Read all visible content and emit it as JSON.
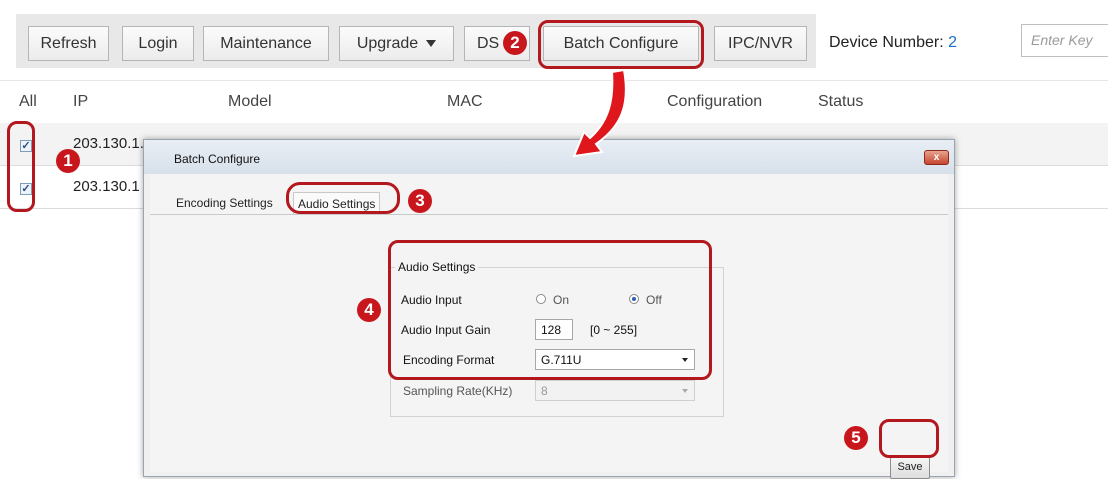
{
  "toolbar": {
    "buttons": [
      {
        "label": "Refresh"
      },
      {
        "label": "Login"
      },
      {
        "label": "Maintenance"
      },
      {
        "label": "Upgrade"
      },
      {
        "label": "DS"
      },
      {
        "label": "Batch Configure"
      },
      {
        "label": "IPC/NVR"
      }
    ],
    "device_number_label": "Device Number:",
    "device_number_value": "2",
    "search_placeholder": "Enter Key"
  },
  "table": {
    "headers": [
      "All",
      "IP",
      "Model",
      "MAC",
      "Configuration",
      "Status"
    ],
    "rows": [
      {
        "ip": "203.130.1.",
        "checked": true
      },
      {
        "ip": "203.130.1",
        "checked": true
      }
    ]
  },
  "dialog": {
    "title": "Batch Configure",
    "tabs": [
      "Encoding Settings",
      "Audio Settings"
    ],
    "active_tab": "Audio Settings",
    "group_title": "Audio Settings",
    "audio_input": {
      "label": "Audio Input",
      "on_label": "On",
      "off_label": "Off",
      "selected": "Off"
    },
    "audio_input_gain": {
      "label": "Audio Input Gain",
      "value": "128",
      "range": "[0 ~ 255]"
    },
    "encoding_format": {
      "label": "Encoding Format",
      "value": "G.711U"
    },
    "sampling_rate": {
      "label": "Sampling Rate(KHz)",
      "value": "8"
    },
    "save_label": "Save",
    "close_glyph": "x"
  },
  "callouts": [
    "1",
    "2",
    "3",
    "4",
    "5"
  ],
  "colors": {
    "callout": "#c8161d",
    "device_number": "#1f6fc6"
  }
}
